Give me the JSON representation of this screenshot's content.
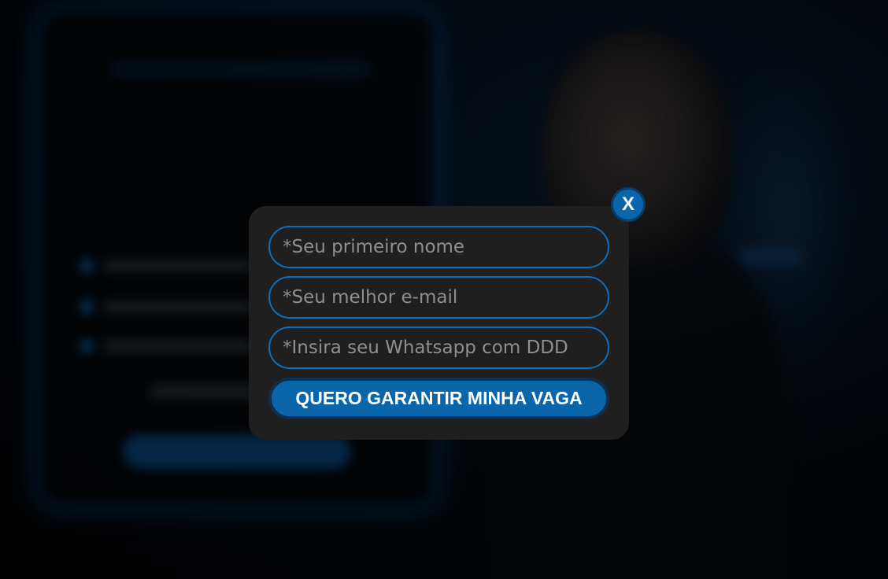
{
  "background": {
    "headline": "",
    "accent_color": "#0d6db7"
  },
  "modal": {
    "close_label": "X",
    "fields": {
      "first_name_placeholder": "*Seu primeiro nome",
      "email_placeholder": "*Seu melhor e-mail",
      "whatsapp_placeholder": "*Insira seu Whatsapp com DDD"
    },
    "submit_label": "QUERO GARANTIR MINHA VAGA",
    "colors": {
      "modal_bg": "#1f1f1f",
      "button_bg": "#0a65ab",
      "field_border": "#0d6db7"
    }
  }
}
